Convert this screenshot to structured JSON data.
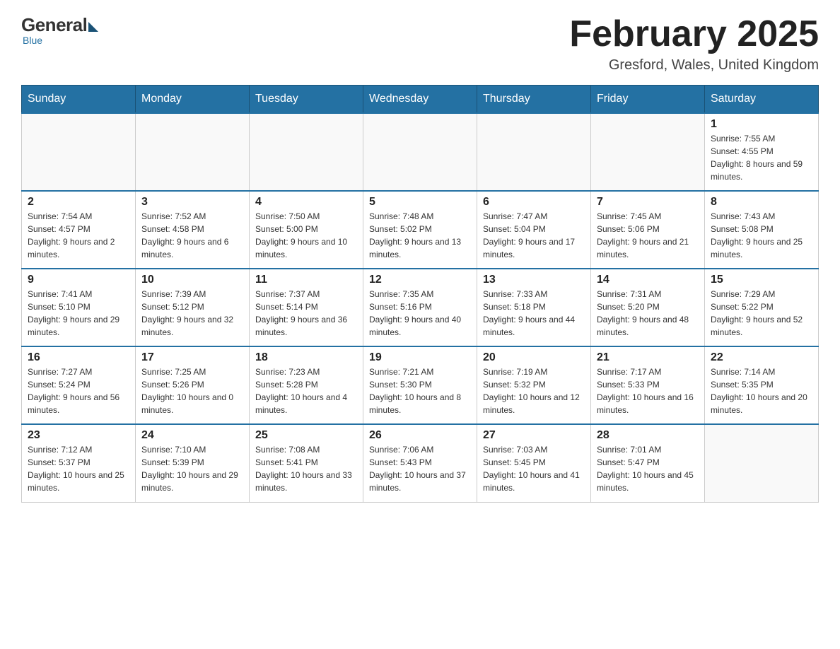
{
  "logo": {
    "general": "General",
    "blue": "Blue",
    "tagline": "Blue"
  },
  "header": {
    "month_year": "February 2025",
    "location": "Gresford, Wales, United Kingdom"
  },
  "days_of_week": [
    "Sunday",
    "Monday",
    "Tuesday",
    "Wednesday",
    "Thursday",
    "Friday",
    "Saturday"
  ],
  "weeks": [
    [
      {
        "day": "",
        "info": ""
      },
      {
        "day": "",
        "info": ""
      },
      {
        "day": "",
        "info": ""
      },
      {
        "day": "",
        "info": ""
      },
      {
        "day": "",
        "info": ""
      },
      {
        "day": "",
        "info": ""
      },
      {
        "day": "1",
        "info": "Sunrise: 7:55 AM\nSunset: 4:55 PM\nDaylight: 8 hours and 59 minutes."
      }
    ],
    [
      {
        "day": "2",
        "info": "Sunrise: 7:54 AM\nSunset: 4:57 PM\nDaylight: 9 hours and 2 minutes."
      },
      {
        "day": "3",
        "info": "Sunrise: 7:52 AM\nSunset: 4:58 PM\nDaylight: 9 hours and 6 minutes."
      },
      {
        "day": "4",
        "info": "Sunrise: 7:50 AM\nSunset: 5:00 PM\nDaylight: 9 hours and 10 minutes."
      },
      {
        "day": "5",
        "info": "Sunrise: 7:48 AM\nSunset: 5:02 PM\nDaylight: 9 hours and 13 minutes."
      },
      {
        "day": "6",
        "info": "Sunrise: 7:47 AM\nSunset: 5:04 PM\nDaylight: 9 hours and 17 minutes."
      },
      {
        "day": "7",
        "info": "Sunrise: 7:45 AM\nSunset: 5:06 PM\nDaylight: 9 hours and 21 minutes."
      },
      {
        "day": "8",
        "info": "Sunrise: 7:43 AM\nSunset: 5:08 PM\nDaylight: 9 hours and 25 minutes."
      }
    ],
    [
      {
        "day": "9",
        "info": "Sunrise: 7:41 AM\nSunset: 5:10 PM\nDaylight: 9 hours and 29 minutes."
      },
      {
        "day": "10",
        "info": "Sunrise: 7:39 AM\nSunset: 5:12 PM\nDaylight: 9 hours and 32 minutes."
      },
      {
        "day": "11",
        "info": "Sunrise: 7:37 AM\nSunset: 5:14 PM\nDaylight: 9 hours and 36 minutes."
      },
      {
        "day": "12",
        "info": "Sunrise: 7:35 AM\nSunset: 5:16 PM\nDaylight: 9 hours and 40 minutes."
      },
      {
        "day": "13",
        "info": "Sunrise: 7:33 AM\nSunset: 5:18 PM\nDaylight: 9 hours and 44 minutes."
      },
      {
        "day": "14",
        "info": "Sunrise: 7:31 AM\nSunset: 5:20 PM\nDaylight: 9 hours and 48 minutes."
      },
      {
        "day": "15",
        "info": "Sunrise: 7:29 AM\nSunset: 5:22 PM\nDaylight: 9 hours and 52 minutes."
      }
    ],
    [
      {
        "day": "16",
        "info": "Sunrise: 7:27 AM\nSunset: 5:24 PM\nDaylight: 9 hours and 56 minutes."
      },
      {
        "day": "17",
        "info": "Sunrise: 7:25 AM\nSunset: 5:26 PM\nDaylight: 10 hours and 0 minutes."
      },
      {
        "day": "18",
        "info": "Sunrise: 7:23 AM\nSunset: 5:28 PM\nDaylight: 10 hours and 4 minutes."
      },
      {
        "day": "19",
        "info": "Sunrise: 7:21 AM\nSunset: 5:30 PM\nDaylight: 10 hours and 8 minutes."
      },
      {
        "day": "20",
        "info": "Sunrise: 7:19 AM\nSunset: 5:32 PM\nDaylight: 10 hours and 12 minutes."
      },
      {
        "day": "21",
        "info": "Sunrise: 7:17 AM\nSunset: 5:33 PM\nDaylight: 10 hours and 16 minutes."
      },
      {
        "day": "22",
        "info": "Sunrise: 7:14 AM\nSunset: 5:35 PM\nDaylight: 10 hours and 20 minutes."
      }
    ],
    [
      {
        "day": "23",
        "info": "Sunrise: 7:12 AM\nSunset: 5:37 PM\nDaylight: 10 hours and 25 minutes."
      },
      {
        "day": "24",
        "info": "Sunrise: 7:10 AM\nSunset: 5:39 PM\nDaylight: 10 hours and 29 minutes."
      },
      {
        "day": "25",
        "info": "Sunrise: 7:08 AM\nSunset: 5:41 PM\nDaylight: 10 hours and 33 minutes."
      },
      {
        "day": "26",
        "info": "Sunrise: 7:06 AM\nSunset: 5:43 PM\nDaylight: 10 hours and 37 minutes."
      },
      {
        "day": "27",
        "info": "Sunrise: 7:03 AM\nSunset: 5:45 PM\nDaylight: 10 hours and 41 minutes."
      },
      {
        "day": "28",
        "info": "Sunrise: 7:01 AM\nSunset: 5:47 PM\nDaylight: 10 hours and 45 minutes."
      },
      {
        "day": "",
        "info": ""
      }
    ]
  ]
}
